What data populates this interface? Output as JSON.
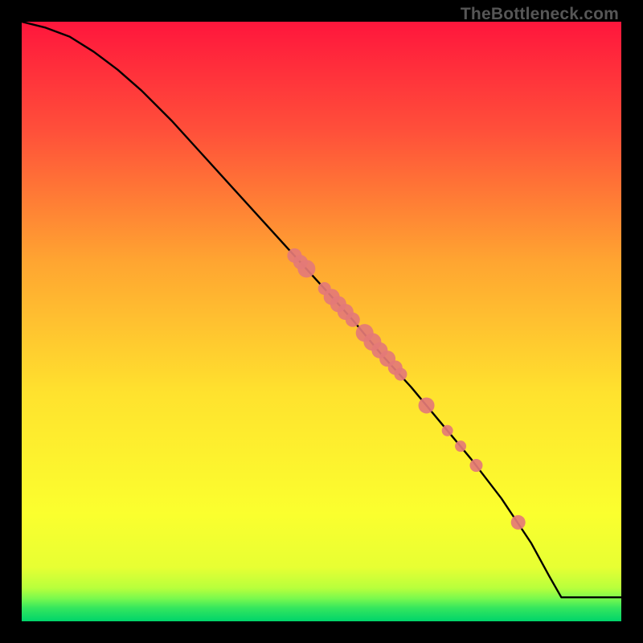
{
  "watermark": "TheBottleneck.com",
  "colors": {
    "frame": "#000000",
    "curve": "#000000",
    "marker_fill": "#e47a77",
    "marker_stroke": "#d86a67",
    "grad_top": "#ff1a3a",
    "grad_mid1": "#ff8a2a",
    "grad_mid2": "#ffe92a",
    "grad_band": "#9bff4a",
    "grad_bottom": "#00e06a"
  },
  "chart_data": {
    "type": "line",
    "title": "",
    "xlabel": "",
    "ylabel": "",
    "xlim": [
      0,
      100
    ],
    "ylim": [
      0,
      100
    ],
    "curve": {
      "x": [
        0,
        4,
        8,
        12,
        16,
        20,
        25,
        30,
        35,
        40,
        45,
        50,
        55,
        60,
        65,
        70,
        75,
        80,
        85,
        88,
        90,
        100
      ],
      "y": [
        100,
        99,
        97.5,
        95,
        92,
        88.5,
        83.5,
        78,
        72.5,
        67,
        61.5,
        56,
        50.5,
        44.5,
        39,
        33,
        27,
        20.5,
        13,
        7.5,
        4,
        4
      ]
    },
    "series": [
      {
        "name": "points",
        "points": [
          {
            "x": 45.5,
            "y": 61.0,
            "r": 9
          },
          {
            "x": 46.5,
            "y": 59.9,
            "r": 9
          },
          {
            "x": 47.5,
            "y": 58.8,
            "r": 11
          },
          {
            "x": 50.5,
            "y": 55.5,
            "r": 8
          },
          {
            "x": 51.7,
            "y": 54.1,
            "r": 10
          },
          {
            "x": 52.8,
            "y": 52.9,
            "r": 10
          },
          {
            "x": 54.0,
            "y": 51.6,
            "r": 10
          },
          {
            "x": 55.2,
            "y": 50.3,
            "r": 9
          },
          {
            "x": 57.2,
            "y": 48.1,
            "r": 11
          },
          {
            "x": 58.5,
            "y": 46.6,
            "r": 11
          },
          {
            "x": 59.7,
            "y": 45.2,
            "r": 10
          },
          {
            "x": 61.0,
            "y": 43.8,
            "r": 10
          },
          {
            "x": 62.3,
            "y": 42.3,
            "r": 9
          },
          {
            "x": 63.2,
            "y": 41.2,
            "r": 8
          },
          {
            "x": 67.5,
            "y": 36.0,
            "r": 10
          },
          {
            "x": 71.0,
            "y": 31.8,
            "r": 7
          },
          {
            "x": 73.2,
            "y": 29.2,
            "r": 7
          },
          {
            "x": 75.8,
            "y": 26.0,
            "r": 8
          },
          {
            "x": 82.8,
            "y": 16.5,
            "r": 9
          }
        ]
      }
    ]
  }
}
